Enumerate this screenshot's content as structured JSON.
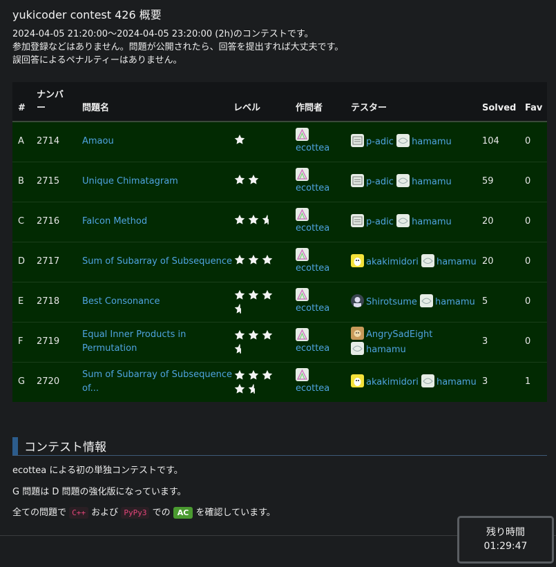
{
  "page_title": "yukicoder contest 426 概要",
  "summary": [
    "2024-04-05 21:20:00〜2024-04-05 23:20:00 (2h)のコンテストです。",
    "参加登録などはありません。問題が公開されたら、回答を提出すれば大丈夫です。",
    "誤回答によるペナルティーはありません。"
  ],
  "table": {
    "headers": {
      "hash": "#",
      "number_line1": "ナンバ",
      "number_line2": "ー",
      "name": "問題名",
      "level": "レベル",
      "author": "作問者",
      "tester": "テスター",
      "solved": "Solved",
      "fav": "Fav"
    },
    "rows": [
      {
        "id": "A",
        "number": "2714",
        "name": "Amaou",
        "level": 1,
        "author": "ecottea",
        "testers": [
          {
            "name": "p-adic",
            "avatar": "padic"
          },
          {
            "name": "hamamu",
            "avatar": "hamamu"
          }
        ],
        "solved": "104",
        "fav": "0"
      },
      {
        "id": "B",
        "number": "2715",
        "name": "Unique Chimatagram",
        "level": 2,
        "author": "ecottea",
        "testers": [
          {
            "name": "p-adic",
            "avatar": "padic"
          },
          {
            "name": "hamamu",
            "avatar": "hamamu"
          }
        ],
        "solved": "59",
        "fav": "0"
      },
      {
        "id": "C",
        "number": "2716",
        "name": "Falcon Method",
        "level": 2.5,
        "author": "ecottea",
        "testers": [
          {
            "name": "p-adic",
            "avatar": "padic"
          },
          {
            "name": "hamamu",
            "avatar": "hamamu"
          }
        ],
        "solved": "20",
        "fav": "0"
      },
      {
        "id": "D",
        "number": "2717",
        "name": "Sum of Subarray of Subsequence",
        "level": 3,
        "author": "ecottea",
        "testers": [
          {
            "name": "akakimidori",
            "avatar": "yellow"
          },
          {
            "name": "hamamu",
            "avatar": "hamamu"
          }
        ],
        "solved": "20",
        "fav": "0"
      },
      {
        "id": "E",
        "number": "2718",
        "name": "Best Consonance",
        "level": 3.5,
        "author": "ecottea",
        "testers": [
          {
            "name": "Shirotsume",
            "avatar": "dark"
          },
          {
            "name": "hamamu",
            "avatar": "hamamu"
          }
        ],
        "solved": "5",
        "fav": "0"
      },
      {
        "id": "F",
        "number": "2719",
        "name": "Equal Inner Products in Permutation",
        "level": 3.5,
        "author": "ecottea",
        "testers": [
          {
            "name": "AngrySadEight",
            "avatar": "brown"
          },
          {
            "name": "hamamu",
            "avatar": "hamamu"
          }
        ],
        "solved": "3",
        "fav": "0"
      },
      {
        "id": "G",
        "number": "2720",
        "name": "Sum of Subarray of Subsequence of...",
        "level": 4.5,
        "author": "ecottea",
        "testers": [
          {
            "name": "akakimidori",
            "avatar": "yellow"
          },
          {
            "name": "hamamu",
            "avatar": "hamamu"
          }
        ],
        "solved": "3",
        "fav": "1"
      }
    ]
  },
  "section": {
    "title": "コンテスト情報",
    "line1": "ecottea による初の単独コンテストです。",
    "line2": "G 問題は D 問題の強化版になっています。",
    "line3_prefix": "全ての問題で",
    "tag_cpp": "C++",
    "line3_and": "および",
    "tag_pypy": "PyPy3",
    "line3_de": "での",
    "badge_ac": "AC",
    "line3_suffix": "を確認しています。"
  },
  "timer": {
    "label": "残り時間",
    "value": "01:29:47"
  },
  "colors": {
    "row_bg": "#022a02",
    "link": "#4fa3e0",
    "section_accent": "#2c5c8c"
  }
}
